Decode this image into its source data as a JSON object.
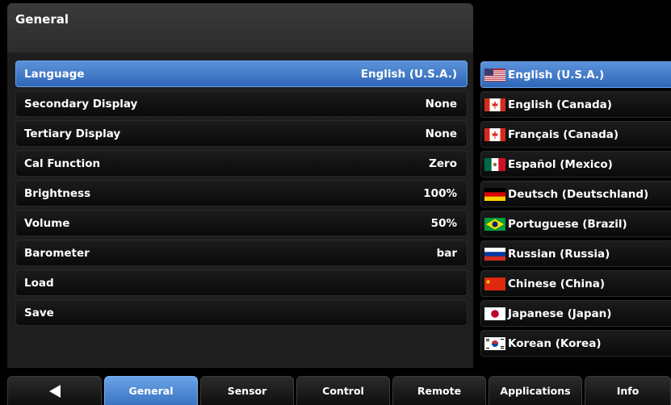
{
  "panel": {
    "title": "General"
  },
  "settings": [
    {
      "label": "Language",
      "value": "English (U.S.A.)",
      "selected": true
    },
    {
      "label": "Secondary Display",
      "value": "None"
    },
    {
      "label": "Tertiary Display",
      "value": "None"
    },
    {
      "label": "Cal Function",
      "value": "Zero"
    },
    {
      "label": "Brightness",
      "value": "100%"
    },
    {
      "label": "Volume",
      "value": "50%"
    },
    {
      "label": "Barometer",
      "value": "bar"
    },
    {
      "label": "Load",
      "value": ""
    },
    {
      "label": "Save",
      "value": ""
    }
  ],
  "languages": [
    {
      "label": "English (U.S.A.)",
      "flag": "us-flag-icon",
      "selected": true
    },
    {
      "label": "English (Canada)",
      "flag": "canada-flag-icon"
    },
    {
      "label": "Français (Canada)",
      "flag": "canada-flag-icon"
    },
    {
      "label": "Español (Mexico)",
      "flag": "mexico-flag-icon"
    },
    {
      "label": "Deutsch (Deutschland)",
      "flag": "germany-flag-icon"
    },
    {
      "label": "Portuguese (Brazil)",
      "flag": "brazil-flag-icon"
    },
    {
      "label": "Russian (Russia)",
      "flag": "russia-flag-icon"
    },
    {
      "label": "Chinese (China)",
      "flag": "china-flag-icon"
    },
    {
      "label": "Japanese (Japan)",
      "flag": "japan-flag-icon"
    },
    {
      "label": "Korean (Korea)",
      "flag": "korea-flag-icon"
    }
  ],
  "tabs": [
    {
      "label": "",
      "icon": "back-arrow-icon"
    },
    {
      "label": "General",
      "active": true
    },
    {
      "label": "Sensor"
    },
    {
      "label": "Control"
    },
    {
      "label": "Remote"
    },
    {
      "label": "Applications"
    },
    {
      "label": "Info"
    }
  ],
  "colors": {
    "selected_start": "#5a92da",
    "selected_end": "#2f67b8",
    "background": "#000000"
  }
}
